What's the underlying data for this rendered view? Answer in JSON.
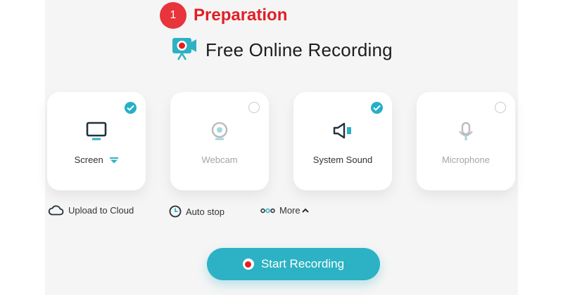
{
  "step": {
    "number": "1",
    "title": "Preparation"
  },
  "app": {
    "title": "Free Online Recording",
    "logo_icon": "camera-record-icon"
  },
  "sources": [
    {
      "label": "Screen",
      "selected": true,
      "icon": "monitor-icon"
    },
    {
      "label": "Webcam",
      "selected": false,
      "icon": "webcam-icon"
    },
    {
      "label": "System Sound",
      "selected": true,
      "icon": "speaker-icon"
    },
    {
      "label": "Microphone",
      "selected": false,
      "icon": "microphone-icon"
    }
  ],
  "options": {
    "upload": "Upload to Cloud",
    "autostop": "Auto stop",
    "more": "More"
  },
  "start_button": {
    "label": "Start Recording"
  },
  "colors": {
    "accent": "#2cb2c4",
    "step_red": "#e11f26",
    "record_red": "#e3201e",
    "panel_bg": "#f5f5f5"
  }
}
